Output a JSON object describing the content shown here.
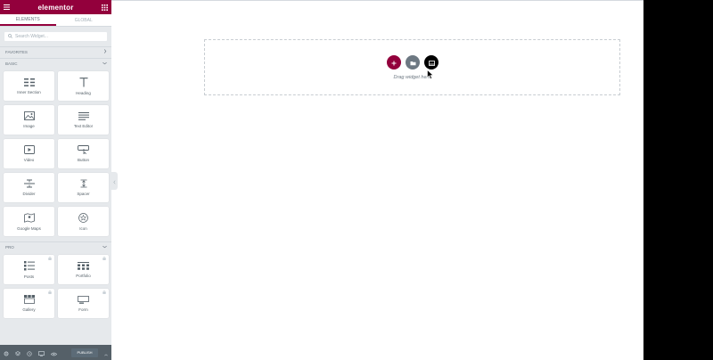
{
  "panel": {
    "logo": "elementor",
    "tabs": [
      "Elements",
      "Global"
    ],
    "search_placeholder": "Search Widget...",
    "categories": {
      "favorites": "Favorites",
      "basic": "Basic",
      "pro": "Pro"
    },
    "basic_widgets": [
      {
        "label": "Inner Section",
        "icon": "inner-section-icon"
      },
      {
        "label": "Heading",
        "icon": "heading-icon"
      },
      {
        "label": "Image",
        "icon": "image-icon"
      },
      {
        "label": "Text Editor",
        "icon": "text-editor-icon"
      },
      {
        "label": "Video",
        "icon": "video-icon"
      },
      {
        "label": "Button",
        "icon": "button-icon"
      },
      {
        "label": "Divider",
        "icon": "divider-icon"
      },
      {
        "label": "Spacer",
        "icon": "spacer-icon"
      },
      {
        "label": "Google Maps",
        "icon": "map-icon"
      },
      {
        "label": "Icon",
        "icon": "star-icon"
      }
    ],
    "pro_widgets": [
      {
        "label": "Posts",
        "icon": "posts-icon"
      },
      {
        "label": "Portfolio",
        "icon": "portfolio-icon"
      },
      {
        "label": "Gallery",
        "icon": "gallery-icon"
      },
      {
        "label": "Form",
        "icon": "form-icon"
      }
    ],
    "footer": {
      "publish_label": "Publish",
      "icons": [
        "settings-icon",
        "navigator-icon",
        "history-icon",
        "responsive-icon",
        "preview-icon"
      ]
    }
  },
  "canvas": {
    "drag_text": "Drag widget here"
  },
  "colors": {
    "brand": "#93003c",
    "panel_bg": "#e6e9ec",
    "footer_bg": "#556068"
  }
}
